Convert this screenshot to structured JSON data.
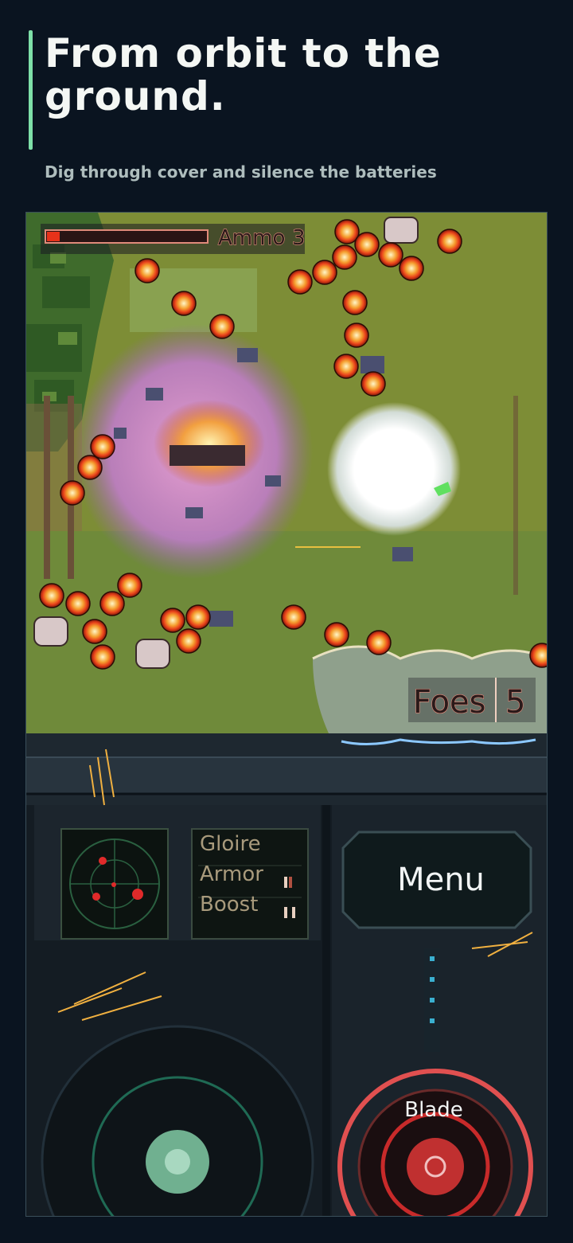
{
  "header": {
    "headline": "From orbit to the ground.",
    "subhead": "Dig through cover and silence the batteries"
  },
  "hud": {
    "ammo_label": "Ammo",
    "ammo_value": "3",
    "foes_label": "Foes",
    "foes_value": "5",
    "health_fraction": 0.08
  },
  "status_panel": {
    "name": "Gloire",
    "armor_label": "Armor",
    "boost_label": "Boost"
  },
  "controls": {
    "menu_label": "Menu",
    "blade_label": "Blade"
  },
  "colors": {
    "accent": "#7ee0a8",
    "background": "#0a1420",
    "enemy_bullet": "#e8401a",
    "hud_outline": "#e08a7a"
  }
}
